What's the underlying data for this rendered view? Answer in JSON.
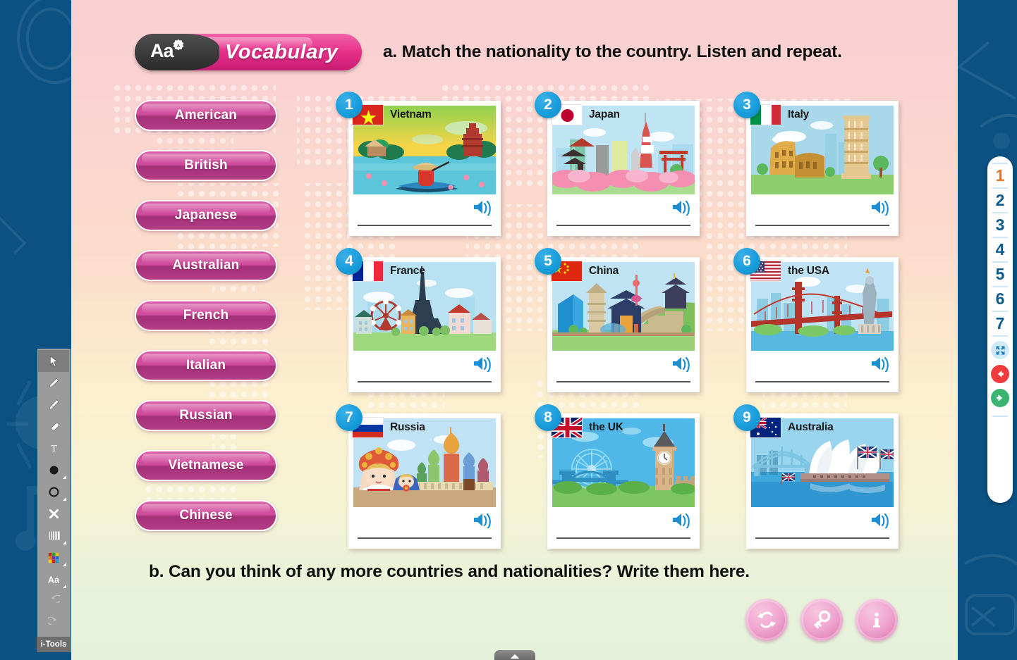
{
  "header": {
    "badge_label": "Vocabulary",
    "badge_icon": "Aa",
    "instruction_a": "a. Match the nationality to the country. Listen and repeat."
  },
  "nationalities": [
    {
      "label": "American"
    },
    {
      "label": "British"
    },
    {
      "label": "Japanese"
    },
    {
      "label": "Australian"
    },
    {
      "label": "French"
    },
    {
      "label": "Italian"
    },
    {
      "label": "Russian"
    },
    {
      "label": "Vietnamese"
    },
    {
      "label": "Chinese"
    }
  ],
  "cards": [
    {
      "number": "1",
      "country": "Vietnam",
      "flag": "vietnam-flag",
      "scene": "vietnam-scene"
    },
    {
      "number": "2",
      "country": "Japan",
      "flag": "japan-flag",
      "scene": "japan-scene"
    },
    {
      "number": "3",
      "country": "Italy",
      "flag": "italy-flag",
      "scene": "italy-scene"
    },
    {
      "number": "4",
      "country": "France",
      "flag": "france-flag",
      "scene": "france-scene"
    },
    {
      "number": "5",
      "country": "China",
      "flag": "china-flag",
      "scene": "china-scene"
    },
    {
      "number": "6",
      "country": "the USA",
      "flag": "usa-flag",
      "scene": "usa-scene"
    },
    {
      "number": "7",
      "country": "Russia",
      "flag": "russia-flag",
      "scene": "russia-scene"
    },
    {
      "number": "8",
      "country": "the UK",
      "flag": "uk-flag",
      "scene": "uk-scene"
    },
    {
      "number": "9",
      "country": "Australia",
      "flag": "australia-flag",
      "scene": "australia-scene"
    }
  ],
  "instruction_b": "b. Can you think of any more countries and nationalities? Write them here.",
  "bottom_actions": [
    {
      "name": "reset-button",
      "icon": "reset-arrows-icon"
    },
    {
      "name": "answer-key-button",
      "icon": "key-icon"
    },
    {
      "name": "info-button",
      "icon": "info-icon"
    }
  ],
  "nav_rail": {
    "pages": [
      "1",
      "2",
      "3",
      "4",
      "5",
      "6",
      "7"
    ],
    "active_page": "1",
    "fullscreen_icon": "fullscreen-icon",
    "back_icon": "arrow-left-icon",
    "next_icon": "arrow-right-icon"
  },
  "toolbar": {
    "label": "i-Tools",
    "tools": [
      {
        "name": "cursor-tool",
        "icon": "cursor-icon",
        "selected": true,
        "disabled": false,
        "corner": false
      },
      {
        "name": "pencil-tool",
        "icon": "pencil-icon",
        "selected": false,
        "disabled": false,
        "corner": false
      },
      {
        "name": "brush-tool",
        "icon": "brush-icon",
        "selected": false,
        "disabled": false,
        "corner": false
      },
      {
        "name": "eraser-tool",
        "icon": "eraser-icon",
        "selected": false,
        "disabled": false,
        "corner": false
      },
      {
        "name": "text-tool",
        "icon": "text-t-icon",
        "selected": false,
        "disabled": false,
        "corner": false
      },
      {
        "name": "fill-shape-tool",
        "icon": "filled-circle-icon",
        "selected": false,
        "disabled": false,
        "corner": true
      },
      {
        "name": "outline-shape-tool",
        "icon": "outline-circle-icon",
        "selected": false,
        "disabled": false,
        "corner": true
      },
      {
        "name": "close-tool",
        "icon": "close-x-icon",
        "selected": false,
        "disabled": false,
        "corner": false
      },
      {
        "name": "line-width-tool",
        "icon": "line-width-icon",
        "selected": false,
        "disabled": false,
        "corner": true
      },
      {
        "name": "color-palette-tool",
        "icon": "color-palette-icon",
        "selected": false,
        "disabled": false,
        "corner": true
      },
      {
        "name": "font-tool",
        "icon": "font-aa-icon",
        "selected": false,
        "disabled": false,
        "corner": true
      },
      {
        "name": "undo-tool",
        "icon": "undo-icon",
        "selected": false,
        "disabled": true,
        "corner": false
      },
      {
        "name": "redo-tool",
        "icon": "redo-icon",
        "selected": false,
        "disabled": true,
        "corner": false
      }
    ]
  },
  "drawer_tab": {
    "icon": "chevron-up-icon"
  },
  "colors": {
    "frame_blue": "#0b5182",
    "badge_pink": "#e8328c",
    "button_magenta": "#cf4b9b",
    "card_number_blue": "#189ddb",
    "rail_active_orange": "#f4721b",
    "rail_blue": "#0c5c91",
    "speaker_blue": "#1b8fd4"
  }
}
